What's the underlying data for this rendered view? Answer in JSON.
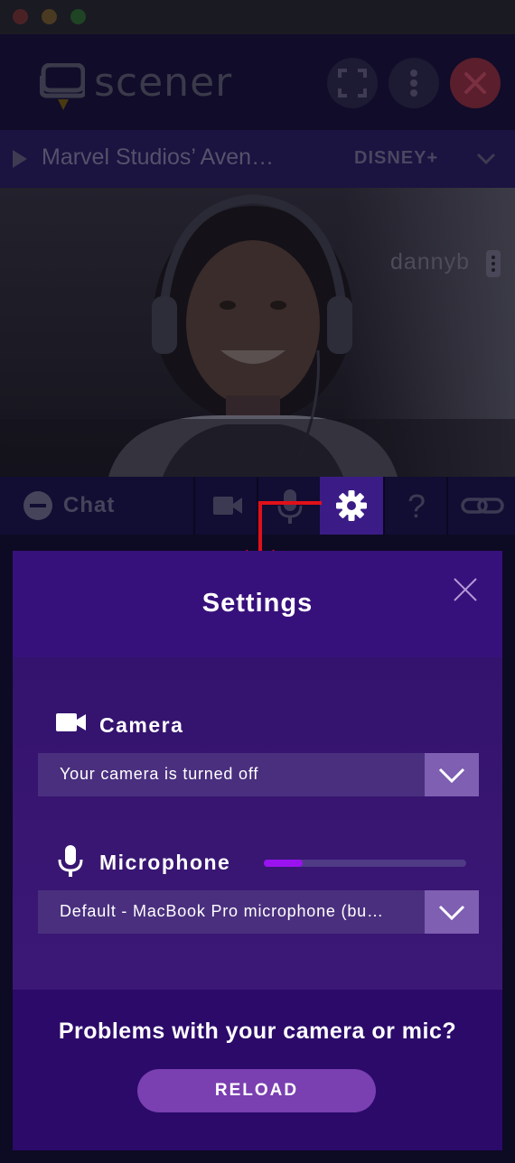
{
  "window": {
    "controls": [
      "close",
      "minimize",
      "zoom"
    ]
  },
  "app": {
    "logo_text": "scener",
    "buttons": {
      "fullscreen_icon": "fullscreen-icon",
      "more_icon": "more-vertical-icon",
      "close_icon": "close-icon"
    }
  },
  "media": {
    "title": "Marvel Studios’ Aven…",
    "service": "DISNEY+"
  },
  "video": {
    "username": "dannyb"
  },
  "toolbar": {
    "chat_label": "Chat",
    "active_tool": "settings"
  },
  "settings": {
    "title": "Settings",
    "camera": {
      "label": "Camera",
      "selected": "Your camera is turned off"
    },
    "microphone": {
      "label": "Microphone",
      "selected": "Default - MacBook Pro microphone (bu…",
      "level": 0.19
    },
    "problems_text": "Problems with your camera or mic?",
    "reload_label": "RELOAD"
  },
  "colors": {
    "accent": "#9a12f0",
    "panel": "#2f0e6e",
    "arrow": "#e0101a",
    "reload": "#7a3fb0"
  }
}
